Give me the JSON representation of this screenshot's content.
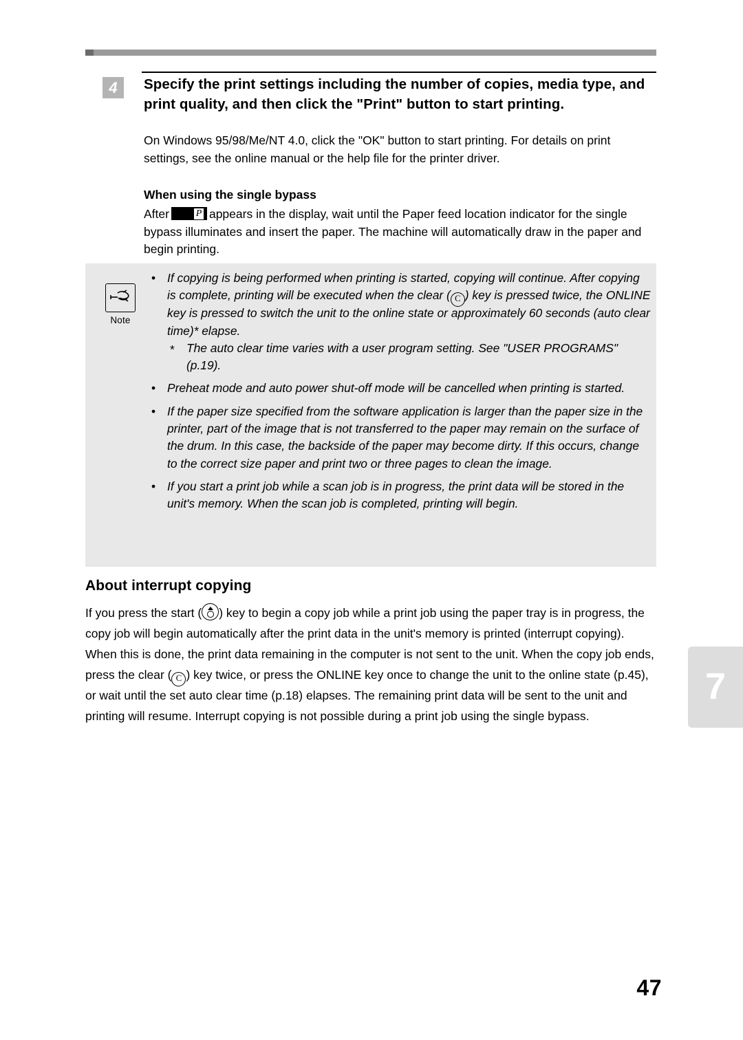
{
  "page": {
    "folio": "47",
    "tab_number": "7"
  },
  "step": {
    "number": "4",
    "heading": "Specify the print settings including the number of copies, media type, and print quality, and then click the \"Print\" button to start printing.",
    "body": "On Windows 95/98/Me/NT 4.0, click the \"OK\" button to start printing. For details on print settings, see the online manual or the help file for the printer driver.",
    "subheading": "When using the single bypass",
    "bypass_before": "After",
    "lcd_glyph": "P",
    "bypass_after": "appears in the display, wait until the Paper feed location indicator for the single bypass illuminates and insert the paper. The machine will automatically draw in the paper and begin printing."
  },
  "note": {
    "label": "Note",
    "icon": "pointing-hand-icon",
    "items": [
      {
        "text_1": "If copying is being performed when printing is started, copying will continue. After copying is complete, printing will be executed when the clear (",
        "key": "C",
        "text_2": ") key is pressed twice, the ONLINE key is pressed to switch the unit to the online state or approximately 60 seconds (auto clear time)* elapse."
      },
      {
        "text_1": "Preheat mode and auto power shut-off mode will be cancelled when printing is started.",
        "key": "",
        "text_2": ""
      },
      {
        "text_1": "If the paper size specified from the software application is larger than the paper size in the printer, part of the image that is not transferred to the paper may remain on the surface of the drum. In this case, the backside of the paper may become dirty. If this occurs, change to the correct size paper and print two or three pages to clean the image.",
        "key": "",
        "text_2": ""
      },
      {
        "text_1": "If you start a print job while a scan job is in progress, the print data will be stored in the unit's memory. When the scan job is completed, printing will begin.",
        "key": "",
        "text_2": ""
      }
    ],
    "footnote": "The auto clear time varies with a user program setting. See \"USER PROGRAMS\" (p.19)."
  },
  "section": {
    "title": "About interrupt copying",
    "text_1": "If you press the start (",
    "start_key": "start-key-icon",
    "text_2": ") key to begin a copy job while a print job using the paper tray is in progress, the copy job will begin automatically after the print data in the unit's memory is printed (interrupt copying). When this is done, the print data remaining in the computer is not sent to the unit. When the copy job ends, press the clear (",
    "clear_key": "C",
    "text_3": ") key twice, or press the ONLINE key once to change the unit to the online state (p.45), or wait until the set auto clear time (p.18) elapses. The remaining print data will be sent to the unit and printing will resume. Interrupt copying is not possible during a print job using the single bypass."
  }
}
